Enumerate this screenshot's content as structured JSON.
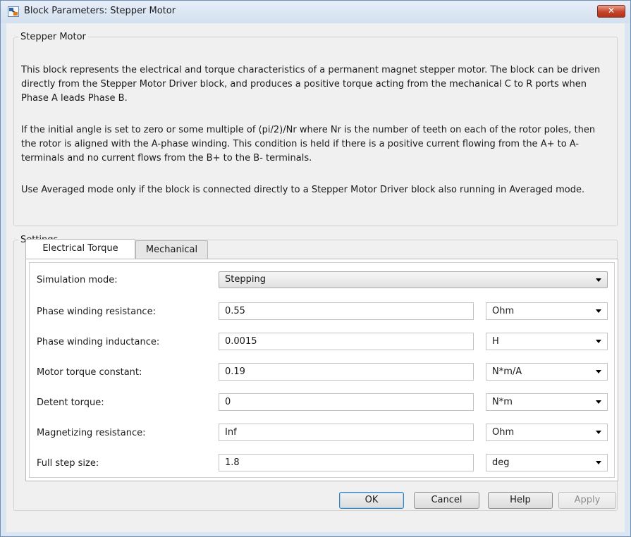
{
  "window": {
    "title": "Block Parameters: Stepper Motor",
    "close_label": "✕"
  },
  "description": {
    "group_title": "Stepper Motor",
    "paragraphs": [
      "This block represents the electrical and torque characteristics of a permanent magnet stepper motor. The block can be driven directly from the Stepper Motor Driver block, and produces a positive torque acting from the mechanical C to R ports when Phase A leads Phase B.",
      "If the initial angle is set to zero or some multiple of (pi/2)/Nr where Nr is the number of teeth on each of the rotor poles, then the rotor is aligned with the A-phase winding. This condition is held if there is a positive current flowing from the A+ to A- terminals and no current flows from the B+ to the B- terminals.",
      "Use Averaged mode only if the block is connected directly to a Stepper Motor Driver block also running in Averaged mode."
    ]
  },
  "settings": {
    "group_title": "Settings",
    "tabs": [
      {
        "label": "Electrical Torque",
        "active": true
      },
      {
        "label": "Mechanical",
        "active": false
      }
    ],
    "simulation_mode": {
      "label": "Simulation mode:",
      "value": "Stepping"
    },
    "params": [
      {
        "label": "Phase winding resistance:",
        "value": "0.55",
        "unit": "Ohm"
      },
      {
        "label": "Phase winding inductance:",
        "value": "0.0015",
        "unit": "H"
      },
      {
        "label": "Motor torque constant:",
        "value": "0.19",
        "unit": "N*m/A"
      },
      {
        "label": "Detent torque:",
        "value": "0",
        "unit": "N*m"
      },
      {
        "label": "Magnetizing resistance:",
        "value": "Inf",
        "unit": "Ohm"
      },
      {
        "label": "Full step size:",
        "value": "1.8",
        "unit": "deg"
      }
    ]
  },
  "buttons": {
    "ok": "OK",
    "cancel": "Cancel",
    "help": "Help",
    "apply": "Apply"
  }
}
